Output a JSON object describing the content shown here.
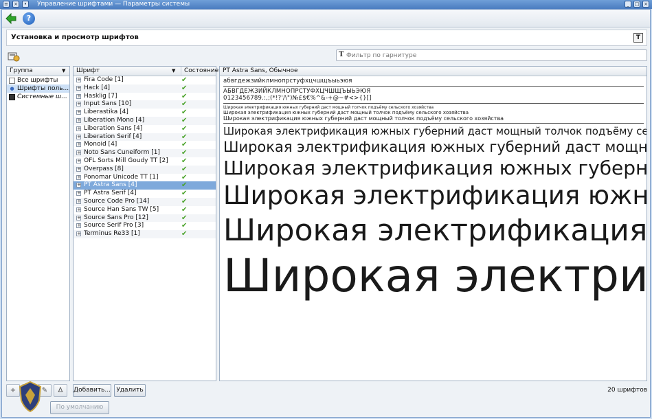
{
  "titlebar": {
    "title": "Управление шрифтами — Параметры системы"
  },
  "header": {
    "title": "Установка и просмотр шрифтов",
    "icon": "font-type-icon"
  },
  "filter": {
    "placeholder": "Фильтр по гарнитуре"
  },
  "groups": {
    "header": "Группа",
    "items": [
      {
        "label": "Все шрифты",
        "icon": "document-icon",
        "selected": false
      },
      {
        "label": "Шрифты поль...",
        "icon": "user-icon",
        "selected": true
      },
      {
        "label": "Системные ш...",
        "icon": "monitor-icon",
        "selected": false
      }
    ]
  },
  "fonts": {
    "header": "Шрифт",
    "state_header": "Состояние",
    "items": [
      {
        "name": "Fira Code [1]",
        "enabled": true
      },
      {
        "name": "Hack [4]",
        "enabled": true
      },
      {
        "name": "Hasklig [7]",
        "enabled": true
      },
      {
        "name": "Input Sans [10]",
        "enabled": true
      },
      {
        "name": "Liberastika [4]",
        "enabled": true
      },
      {
        "name": "Liberation Mono [4]",
        "enabled": true
      },
      {
        "name": "Liberation Sans [4]",
        "enabled": true
      },
      {
        "name": "Liberation Serif [4]",
        "enabled": true
      },
      {
        "name": "Monoid [4]",
        "enabled": true
      },
      {
        "name": "Noto Sans Cuneiform [1]",
        "enabled": true
      },
      {
        "name": "OFL Sorts Mill Goudy TT [2]",
        "enabled": true
      },
      {
        "name": "Overpass [8]",
        "enabled": true
      },
      {
        "name": "Ponomar Unicode TT [1]",
        "enabled": true
      },
      {
        "name": "PT Astra Sans [4]",
        "enabled": true,
        "selected": true
      },
      {
        "name": "PT Astra Serif [4]",
        "enabled": true
      },
      {
        "name": "Source Code Pro [14]",
        "enabled": true
      },
      {
        "name": "Source Han Sans TW [5]",
        "enabled": true
      },
      {
        "name": "Source Sans Pro [12]",
        "enabled": true
      },
      {
        "name": "Source Serif Pro [3]",
        "enabled": true
      },
      {
        "name": "Terminus Re33 [1]",
        "enabled": true
      }
    ]
  },
  "preview": {
    "header": "PT Astra Sans, Обычное",
    "lowercase": "абвгдежзийклмнопрстуфхцчшщъыьэюя",
    "uppercase": "АБВГДЕЖЗИЙКЛМНОПРСТУФХЦЧШЩЪЫЬЭЮЯ",
    "digits": "0123456789.:,;(*!?'/\\\")№£$€%^&-+@~#<>{}[]",
    "sample_text": "Широкая электрификация южных губерний даст мощный толчок подъёму сельского хозяйства"
  },
  "bottom": {
    "add_label": "Добавить...",
    "delete_label": "Удалить",
    "default_label": "По умолчанию",
    "count": "20 шрифтов"
  }
}
